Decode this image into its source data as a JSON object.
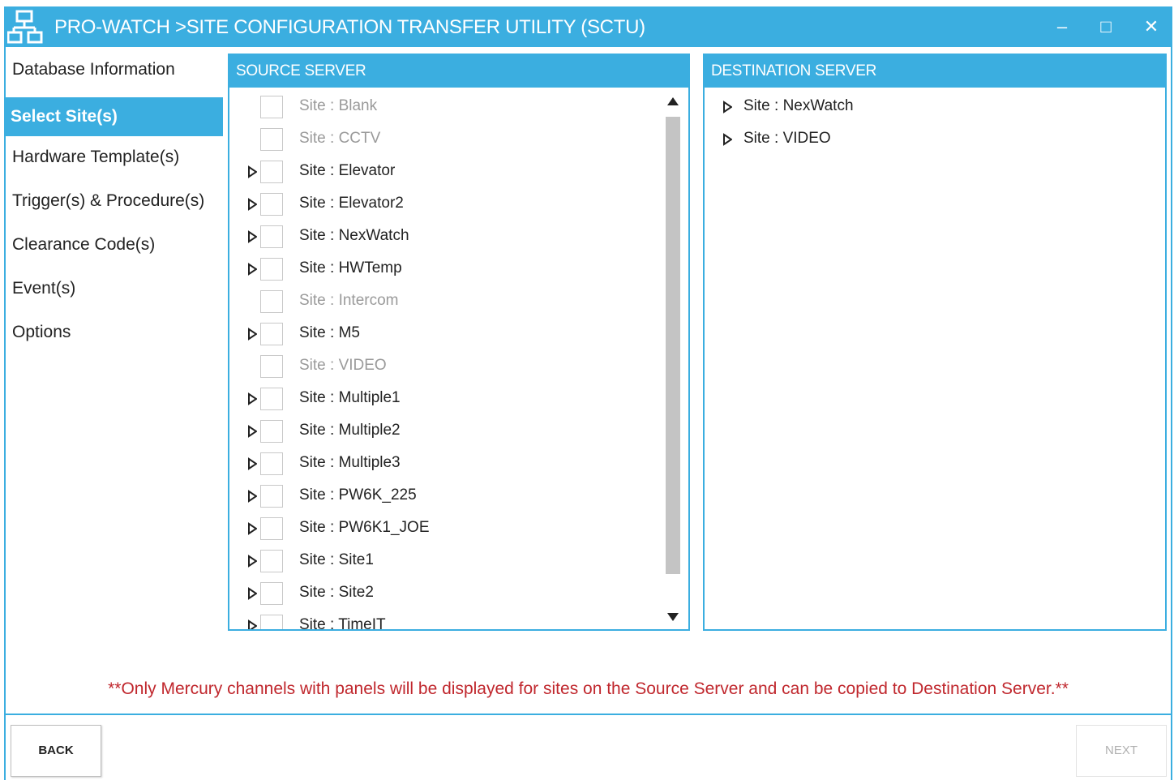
{
  "window": {
    "title": "PRO-WATCH >SITE CONFIGURATION TRANSFER UTILITY (SCTU)",
    "minimize": "–",
    "maximize": "□",
    "close": "✕",
    "accent": "#3baee0"
  },
  "sidebar": {
    "items": [
      {
        "label": "Database Information",
        "active": false
      },
      {
        "label": "Select Site(s)",
        "active": true
      },
      {
        "label": "Hardware Template(s)",
        "active": false
      },
      {
        "label": "Trigger(s) & Procedure(s)",
        "active": false
      },
      {
        "label": "Clearance Code(s)",
        "active": false
      },
      {
        "label": "Event(s)",
        "active": false
      },
      {
        "label": "Options",
        "active": false
      }
    ]
  },
  "source": {
    "header": "SOURCE SERVER",
    "rows": [
      {
        "label": "Site : Blank",
        "expandable": false,
        "enabled": false,
        "checked": false
      },
      {
        "label": "Site : CCTV",
        "expandable": false,
        "enabled": false,
        "checked": false
      },
      {
        "label": "Site : Elevator",
        "expandable": true,
        "enabled": true,
        "checked": false
      },
      {
        "label": "Site : Elevator2",
        "expandable": true,
        "enabled": true,
        "checked": false
      },
      {
        "label": "Site : NexWatch",
        "expandable": true,
        "enabled": true,
        "checked": false
      },
      {
        "label": "Site : HWTemp",
        "expandable": true,
        "enabled": true,
        "checked": false
      },
      {
        "label": "Site : Intercom",
        "expandable": false,
        "enabled": false,
        "checked": false
      },
      {
        "label": "Site : M5",
        "expandable": true,
        "enabled": true,
        "checked": false
      },
      {
        "label": "Site : VIDEO",
        "expandable": false,
        "enabled": false,
        "checked": false
      },
      {
        "label": "Site : Multiple1",
        "expandable": true,
        "enabled": true,
        "checked": false
      },
      {
        "label": "Site : Multiple2",
        "expandable": true,
        "enabled": true,
        "checked": false
      },
      {
        "label": "Site : Multiple3",
        "expandable": true,
        "enabled": true,
        "checked": false
      },
      {
        "label": "Site : PW6K_225",
        "expandable": true,
        "enabled": true,
        "checked": false
      },
      {
        "label": "Site : PW6K1_JOE",
        "expandable": true,
        "enabled": true,
        "checked": false
      },
      {
        "label": "Site : Site1",
        "expandable": true,
        "enabled": true,
        "checked": false
      },
      {
        "label": "Site : Site2",
        "expandable": true,
        "enabled": true,
        "checked": false
      },
      {
        "label": "Site : TimeIT",
        "expandable": true,
        "enabled": true,
        "checked": false
      }
    ]
  },
  "destination": {
    "header": "DESTINATION SERVER",
    "rows": [
      {
        "label": "Site : NexWatch"
      },
      {
        "label": "Site : VIDEO"
      }
    ]
  },
  "notice": "**Only Mercury channels with panels will be displayed for sites on the Source Server and can be copied to Destination Server.**",
  "footer": {
    "back_label": "BACK",
    "next_label": "NEXT",
    "next_enabled": false
  }
}
